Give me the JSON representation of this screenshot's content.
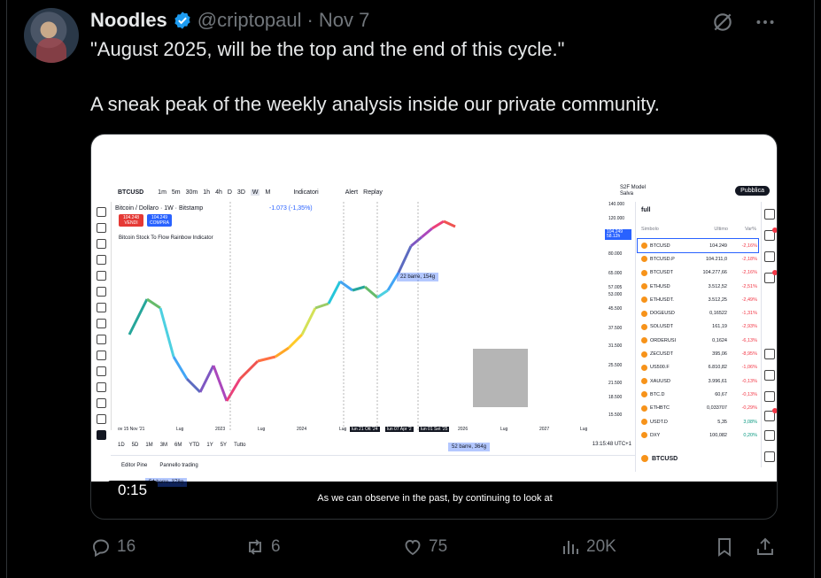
{
  "tweet": {
    "author_name": "Noodles",
    "handle": "@criptopaul",
    "separator": "·",
    "date": "Nov 7",
    "line1": "\"August 2025, will be the top and the end of this cycle.\"",
    "line2": "A sneak peak of the weekly analysis inside our private community."
  },
  "video": {
    "timecode": "0:15",
    "caption": "As we can observe in the past, by continuing to look at"
  },
  "tradingview": {
    "symbol": "BTCUSD",
    "timeframes": [
      "1m",
      "5m",
      "30m",
      "1h",
      "4h",
      "D",
      "3D",
      "W",
      "M"
    ],
    "indicators_label": "Indicatori",
    "alert_label": "Alert",
    "replay_label": "Replay",
    "model_label": "S2F Model",
    "model_sub": "Salva",
    "publish_label": "Pubblica",
    "chart_title": "Bitcoin / Dollaro · 1W · Bitstamp",
    "chart_change": "-1.073 (-1,35%)",
    "sell_box": "104.248 VENDI",
    "buy_box": "104.249 COMPRA",
    "indicator_name": "Bitcoin Stock To Flow Rainbow Indicator",
    "annotation_top": "22 barre, 154g",
    "annotation_mid": "52 barre, 364g",
    "annotation_low": "54 barre, 378g",
    "price_ticks": [
      "140.000",
      "120.000",
      "104.249",
      "80.000",
      "65.000",
      "57.005",
      "53.000",
      "45.500",
      "37.500",
      "31.500",
      "25.500",
      "21.500",
      "18.500",
      "15.500"
    ],
    "price_tag_sub": "58.12h",
    "time_ticks": [
      "ov 15 Nov '21",
      "Lug",
      "2023",
      "Lug",
      "2024",
      "Lug",
      "lun 21 Ott '24",
      "lun 07 Apr '2",
      "lun 01 Set '25",
      "2026",
      "Lug",
      "2027",
      "Lug"
    ],
    "ranges": [
      "1D",
      "5D",
      "1M",
      "3M",
      "6M",
      "YTD",
      "1Y",
      "5Y",
      "Tutto"
    ],
    "clock": "13:15:48 UTC+1",
    "panel_tabs": [
      "Editor Pine",
      "Pannello trading"
    ],
    "watchlist": {
      "title": "full",
      "col_symbol": "Simbolo",
      "col_last": "Ultimo",
      "col_change": "Var%",
      "rows": [
        {
          "sym": "BTCUSD",
          "last": "104.249",
          "chg": "-2,16%"
        },
        {
          "sym": "BTCUSD.P",
          "last": "104.211,0",
          "chg": "-2,18%"
        },
        {
          "sym": "BTCUSDT",
          "last": "104.277,66",
          "chg": "-2,16%"
        },
        {
          "sym": "ETHUSD",
          "last": "3.512,52",
          "chg": "-2,51%"
        },
        {
          "sym": "ETHUSDT.",
          "last": "3.512,25",
          "chg": "-2,49%"
        },
        {
          "sym": "DOGEUSD",
          "last": "0,16522",
          "chg": "-1,31%"
        },
        {
          "sym": "SOLUSDT",
          "last": "161,19",
          "chg": "-2,93%"
        },
        {
          "sym": "ORDERUSI",
          "last": "0,1624",
          "chg": "-6,13%"
        },
        {
          "sym": "ZECUSDT",
          "last": "395,06",
          "chg": "-8,95%"
        },
        {
          "sym": "US500.F",
          "last": "6.810,82",
          "chg": "-1,06%"
        },
        {
          "sym": "XAUUSD",
          "last": "3.996,61",
          "chg": "-0,13%"
        },
        {
          "sym": "BTC.D",
          "last": "60,67",
          "chg": "-0,13%"
        },
        {
          "sym": "ETHBTC",
          "last": "0,033707",
          "chg": "-0,29%"
        },
        {
          "sym": "USDT.D",
          "last": "5,35",
          "chg": "3,08%"
        },
        {
          "sym": "DXY",
          "last": "100,082",
          "chg": "0,20%"
        }
      ],
      "footer_symbol": "BTCUSD"
    }
  },
  "actions": {
    "replies": "16",
    "reposts": "6",
    "likes": "75",
    "views": "20K"
  },
  "colors": {
    "background": "#000000",
    "text": "#e7e9ea",
    "muted": "#71767b",
    "verified": "#1d9bf0"
  }
}
